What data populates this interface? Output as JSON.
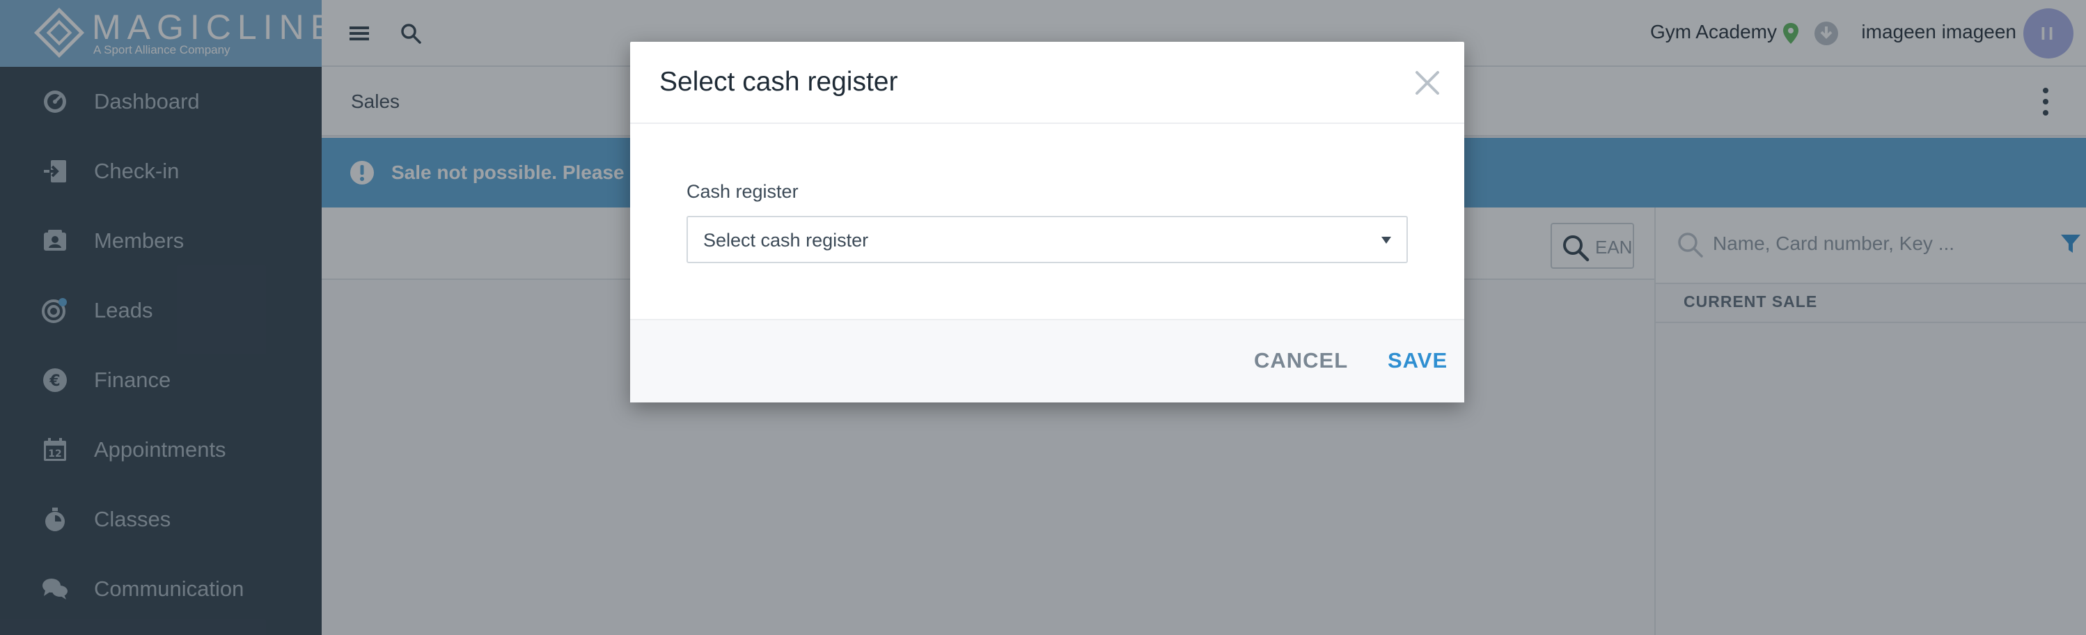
{
  "brand": {
    "name": "MAGICLINE",
    "tagline": "A Sport Alliance Company"
  },
  "sidebar": {
    "items": [
      {
        "label": "Dashboard",
        "icon": "dashboard-gauge-icon"
      },
      {
        "label": "Check-in",
        "icon": "check-in-icon"
      },
      {
        "label": "Members",
        "icon": "members-icon"
      },
      {
        "label": "Leads",
        "icon": "leads-target-icon"
      },
      {
        "label": "Finance",
        "icon": "euro-icon"
      },
      {
        "label": "Appointments",
        "icon": "calendar-icon"
      },
      {
        "label": "Classes",
        "icon": "stopwatch-icon"
      },
      {
        "label": "Communication",
        "icon": "chat-bubbles-icon"
      }
    ]
  },
  "topbar": {
    "studio": "Gym Academy",
    "username": "imageen imageen",
    "avatar_initials": "II"
  },
  "breadcrumb": {
    "page": "Sales"
  },
  "alert": {
    "text": "Sale not possible. Please sel"
  },
  "left_toolbar": {
    "ean_placeholder": "EAN"
  },
  "right_pane": {
    "search_placeholder": "Name, Card number, Key ...",
    "current_sale_label": "CURRENT SALE"
  },
  "modal": {
    "title": "Select cash register",
    "field_label": "Cash register",
    "select_placeholder": "Select cash register",
    "cancel_label": "CANCEL",
    "save_label": "SAVE"
  },
  "colors": {
    "sidebar_bg": "#2f3f4c",
    "brand_accent": "#7db0d3",
    "alert_bg": "#5aa6d8",
    "primary": "#2f8fd1",
    "pin_green": "#5cb85c",
    "avatar_bg": "#a8b0e8"
  }
}
